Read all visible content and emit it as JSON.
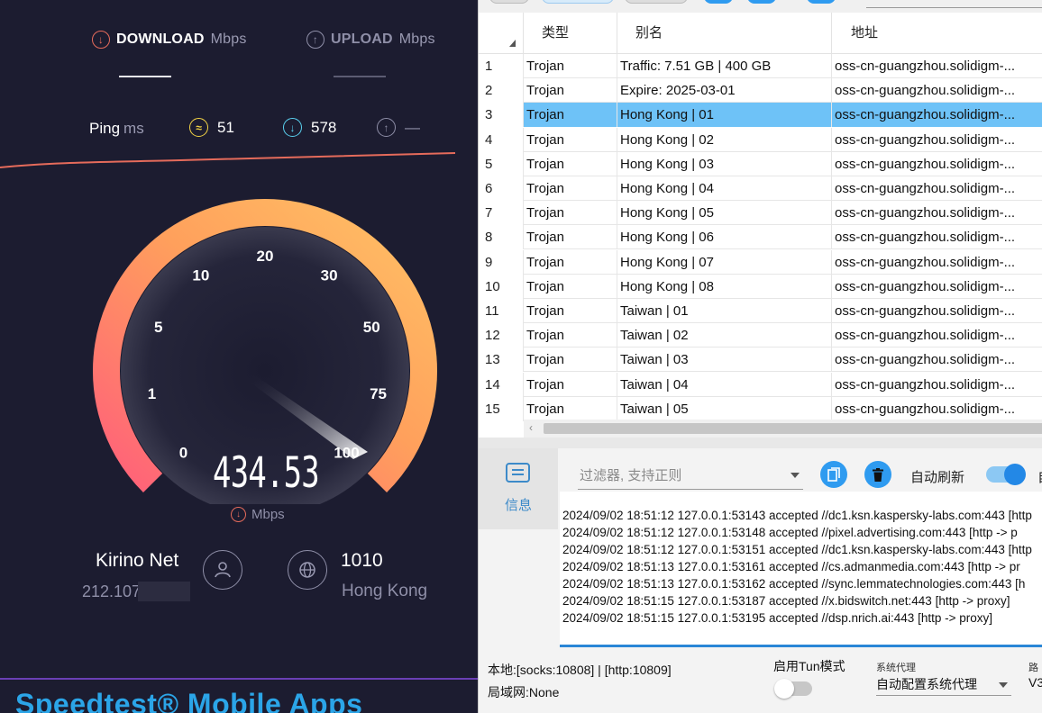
{
  "speedtest": {
    "download_label": "DOWNLOAD",
    "download_unit": "Mbps",
    "upload_label": "UPLOAD",
    "upload_unit": "Mbps",
    "ping_label": "Ping",
    "ping_unit": "ms",
    "ping_idle": "51",
    "ping_download": "578",
    "ping_upload": "—",
    "gauge_ticks": [
      "0",
      "1",
      "5",
      "10",
      "20",
      "30",
      "50",
      "75",
      "100"
    ],
    "speed_value": "434.53",
    "speed_unit": "Mbps",
    "isp_name": "Kirino Net",
    "isp_ip": "212.107",
    "server_id": "1010",
    "server_location": "Hong Kong",
    "footer_title": "Speedtest® Mobile Apps",
    "colors": {
      "accent_orange": "#ffb25b",
      "accent_pink": "#ff5f7a",
      "download": "#e56b5b",
      "idle": "#f5d545",
      "ping_dl": "#5ad1f0",
      "footer": "#2ba5e8"
    }
  },
  "v2ray": {
    "columns": [
      "类型",
      "别名",
      "地址"
    ],
    "rows": [
      {
        "idx": "1",
        "type": "Trojan",
        "alias": "Traffic: 7.51 GB | 400 GB",
        "address": "oss-cn-guangzhou.solidigm-..."
      },
      {
        "idx": "2",
        "type": "Trojan",
        "alias": "Expire: 2025-03-01",
        "address": "oss-cn-guangzhou.solidigm-..."
      },
      {
        "idx": "3",
        "type": "Trojan",
        "alias": "Hong Kong | 01",
        "address": "oss-cn-guangzhou.solidigm-..."
      },
      {
        "idx": "4",
        "type": "Trojan",
        "alias": "Hong Kong | 02",
        "address": "oss-cn-guangzhou.solidigm-..."
      },
      {
        "idx": "5",
        "type": "Trojan",
        "alias": "Hong Kong | 03",
        "address": "oss-cn-guangzhou.solidigm-..."
      },
      {
        "idx": "6",
        "type": "Trojan",
        "alias": "Hong Kong | 04",
        "address": "oss-cn-guangzhou.solidigm-..."
      },
      {
        "idx": "7",
        "type": "Trojan",
        "alias": "Hong Kong | 05",
        "address": "oss-cn-guangzhou.solidigm-..."
      },
      {
        "idx": "8",
        "type": "Trojan",
        "alias": "Hong Kong | 06",
        "address": "oss-cn-guangzhou.solidigm-..."
      },
      {
        "idx": "9",
        "type": "Trojan",
        "alias": "Hong Kong | 07",
        "address": "oss-cn-guangzhou.solidigm-..."
      },
      {
        "idx": "10",
        "type": "Trojan",
        "alias": "Hong Kong | 08",
        "address": "oss-cn-guangzhou.solidigm-..."
      },
      {
        "idx": "11",
        "type": "Trojan",
        "alias": "Taiwan | 01",
        "address": "oss-cn-guangzhou.solidigm-..."
      },
      {
        "idx": "12",
        "type": "Trojan",
        "alias": "Taiwan | 02",
        "address": "oss-cn-guangzhou.solidigm-..."
      },
      {
        "idx": "13",
        "type": "Trojan",
        "alias": "Taiwan | 03",
        "address": "oss-cn-guangzhou.solidigm-..."
      },
      {
        "idx": "14",
        "type": "Trojan",
        "alias": "Taiwan | 04",
        "address": "oss-cn-guangzhou.solidigm-..."
      },
      {
        "idx": "15",
        "type": "Trojan",
        "alias": "Taiwan | 05",
        "address": "oss-cn-guangzhou.solidigm-..."
      }
    ],
    "selected_row": "3",
    "tab_label": "信息",
    "filter_placeholder": "过滤器, 支持正则",
    "auto_refresh_label": "自动刷新",
    "auto_refresh_truncated": "自",
    "log_lines": [
      "2024/09/02 18:51:12 127.0.0.1:53143 accepted //dc1.ksn.kaspersky-labs.com:443 [http",
      "2024/09/02 18:51:12 127.0.0.1:53148 accepted //pixel.advertising.com:443 [http -> p",
      "2024/09/02 18:51:12 127.0.0.1:53151 accepted //dc1.ksn.kaspersky-labs.com:443 [http",
      "2024/09/02 18:51:13 127.0.0.1:53161 accepted //cs.admanmedia.com:443 [http -> pr",
      "2024/09/02 18:51:13 127.0.0.1:53162 accepted //sync.lemmatechnologies.com:443 [h",
      "2024/09/02 18:51:15 127.0.0.1:53187 accepted //x.bidswitch.net:443 [http -> proxy]",
      "2024/09/02 18:51:15 127.0.0.1:53195 accepted //dsp.nrich.ai:443 [http -> proxy]"
    ],
    "local_ports": "本地:[socks:10808] | [http:10809]",
    "lan": "局域网:None",
    "tun_label": "启用Tun模式",
    "sysproxy_label": "系统代理",
    "sysproxy_value": "自动配置系统代理",
    "route_label": "路",
    "route_value": "V3",
    "colors": {
      "selection": "#6ec2f7",
      "accent": "#2f9bf0",
      "tab_text": "#3c8ac9"
    }
  }
}
